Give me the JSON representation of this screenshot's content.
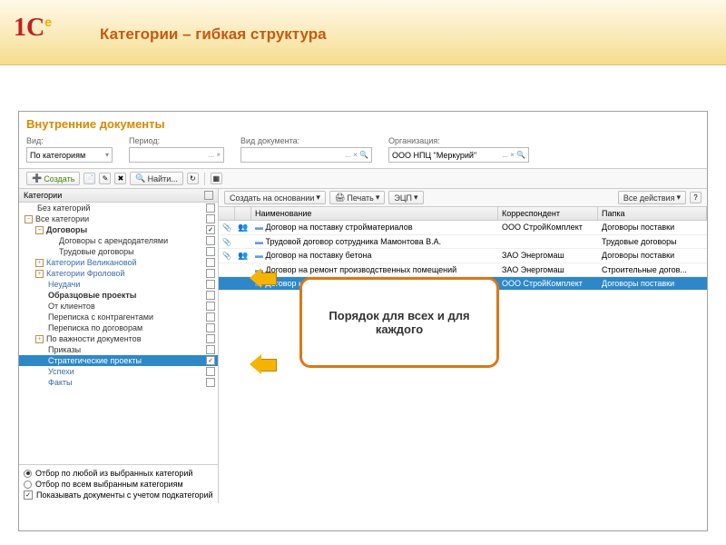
{
  "slide_title": "Категории – гибкая структура",
  "app": {
    "title": "Внутренние документы",
    "filters": {
      "view_lbl": "Вид:",
      "view_val": "По категориям",
      "period_lbl": "Период:",
      "doctype_lbl": "Вид документа:",
      "org_lbl": "Организация:",
      "org_val": "ООО НПЦ \"Меркурий\""
    },
    "toolbar": {
      "create": "Создать",
      "find": "Найти..."
    },
    "tree": {
      "header": "Категории",
      "items": [
        {
          "label": "Без категорий",
          "indent": 0,
          "exp": "",
          "bold": false,
          "blue": false,
          "sel": false,
          "chk": false
        },
        {
          "label": "Все категории",
          "indent": 0,
          "exp": "−",
          "bold": false,
          "blue": false,
          "sel": false,
          "chk": false
        },
        {
          "label": "Договоры",
          "indent": 1,
          "exp": "−",
          "bold": true,
          "blue": false,
          "sel": false,
          "chk": true
        },
        {
          "label": "Договоры с арендодателями",
          "indent": 2,
          "exp": "",
          "bold": false,
          "blue": false,
          "sel": false,
          "chk": false
        },
        {
          "label": "Трудовые договоры",
          "indent": 2,
          "exp": "",
          "bold": false,
          "blue": false,
          "sel": false,
          "chk": false
        },
        {
          "label": "Категории Великановой",
          "indent": 1,
          "exp": "+",
          "bold": false,
          "blue": true,
          "sel": false,
          "chk": false
        },
        {
          "label": "Категории Фроловой",
          "indent": 1,
          "exp": "+",
          "bold": false,
          "blue": true,
          "sel": false,
          "chk": false
        },
        {
          "label": "Неудачи",
          "indent": 1,
          "exp": "",
          "bold": false,
          "blue": true,
          "sel": false,
          "chk": false
        },
        {
          "label": "Образцовые проекты",
          "indent": 1,
          "exp": "",
          "bold": true,
          "blue": false,
          "sel": false,
          "chk": false
        },
        {
          "label": "От клиентов",
          "indent": 1,
          "exp": "",
          "bold": false,
          "blue": false,
          "sel": false,
          "chk": false
        },
        {
          "label": "Переписка с контрагентами",
          "indent": 1,
          "exp": "",
          "bold": false,
          "blue": false,
          "sel": false,
          "chk": false
        },
        {
          "label": "Переписка по договорам",
          "indent": 1,
          "exp": "",
          "bold": false,
          "blue": false,
          "sel": false,
          "chk": false
        },
        {
          "label": "По важности документов",
          "indent": 1,
          "exp": "+",
          "bold": false,
          "blue": false,
          "sel": false,
          "chk": false
        },
        {
          "label": "Приказы",
          "indent": 1,
          "exp": "",
          "bold": false,
          "blue": false,
          "sel": false,
          "chk": false
        },
        {
          "label": "Стратегические проекты",
          "indent": 1,
          "exp": "",
          "bold": false,
          "blue": false,
          "sel": true,
          "chk": true
        },
        {
          "label": "Успехи",
          "indent": 1,
          "exp": "",
          "bold": false,
          "blue": true,
          "sel": false,
          "chk": false
        },
        {
          "label": "Факты",
          "indent": 1,
          "exp": "",
          "bold": false,
          "blue": true,
          "sel": false,
          "chk": false
        }
      ]
    },
    "radios": {
      "r1": "Отбор по любой из выбранных категорий",
      "r2": "Отбор по всем выбранным категориям",
      "cb": "Показывать документы с учетом подкатегорий"
    },
    "rtool": {
      "createon": "Создать на основании",
      "print": "Печать",
      "ecp": "ЭЦП",
      "all": "Все действия"
    },
    "grid": {
      "h_name": "Наименование",
      "h_corr": "Корреспондент",
      "h_folder": "Папка",
      "rows": [
        {
          "pin": true,
          "ppl": true,
          "name": "Договор на поставку стройматериалов",
          "corr": "ООО СтройКомплект",
          "folder": "Договоры поставки",
          "sel": false
        },
        {
          "pin": true,
          "ppl": false,
          "name": "Трудовой договор сотрудника Мамонтова В.А.",
          "corr": "",
          "folder": "Трудовые договоры",
          "sel": false
        },
        {
          "pin": true,
          "ppl": true,
          "name": "Договор на поставку бетона",
          "corr": "ЗАО Энергомаш",
          "folder": "Договоры поставки",
          "sel": false
        },
        {
          "pin": false,
          "ppl": false,
          "name": "Договор на ремонт производственных помещений",
          "corr": "ЗАО Энергомаш",
          "folder": "Строительные догов...",
          "sel": false
        },
        {
          "pin": false,
          "ppl": false,
          "name": "Договор на поставку крепежа",
          "corr": "ООО СтройКомплект",
          "folder": "Договоры поставки",
          "sel": true
        }
      ]
    }
  },
  "callout": "Порядок для всех и для каждого"
}
